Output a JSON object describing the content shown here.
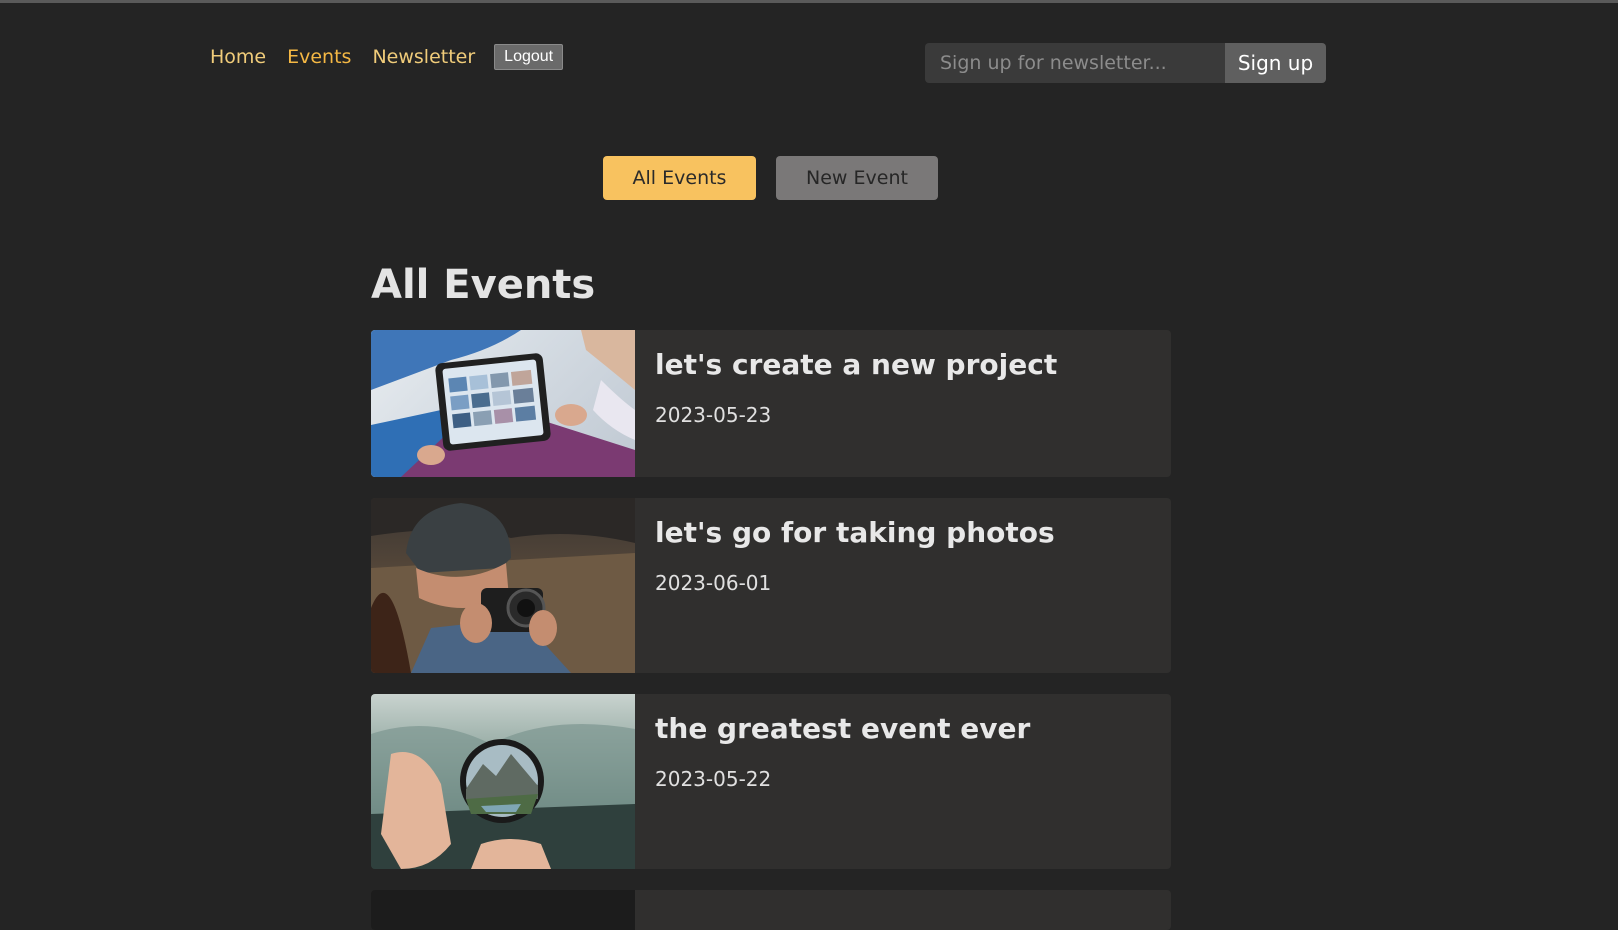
{
  "nav": {
    "links": [
      "Home",
      "Events",
      "Newsletter"
    ],
    "logout_label": "Logout"
  },
  "newsletter": {
    "placeholder": "Sign up for newsletter...",
    "button_label": "Sign up"
  },
  "subnav": {
    "all_label": "All Events",
    "new_label": "New Event"
  },
  "page_title": "All Events",
  "events": [
    {
      "title": "let's create a new project",
      "date": "2023-05-23"
    },
    {
      "title": "let's go for taking photos",
      "date": "2023-06-01"
    },
    {
      "title": "the greatest event ever",
      "date": "2023-05-22"
    }
  ],
  "colors": {
    "background": "#242424",
    "accent": "#f8c25f",
    "nav_link": "#f0cc7a",
    "card": "#302f2e"
  }
}
